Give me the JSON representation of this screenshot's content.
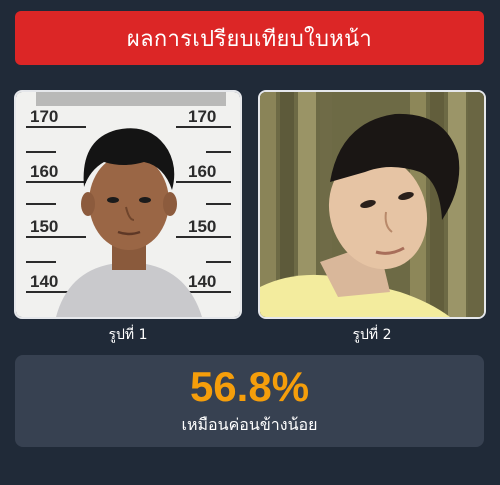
{
  "header": {
    "title": "ผลการเปรียบเทียบใบหน้า",
    "accent_color": "#dc2626"
  },
  "photos": [
    {
      "caption": "รูปที่ 1",
      "height_chart_labels": [
        "170",
        "170",
        "160",
        "160",
        "150",
        "150",
        "140",
        "140"
      ]
    },
    {
      "caption": "รูปที่ 2"
    }
  ],
  "result": {
    "percentage": "56.8%",
    "description": "เหมือนค่อนข้างน้อย",
    "percentage_color": "#f59e0b"
  }
}
